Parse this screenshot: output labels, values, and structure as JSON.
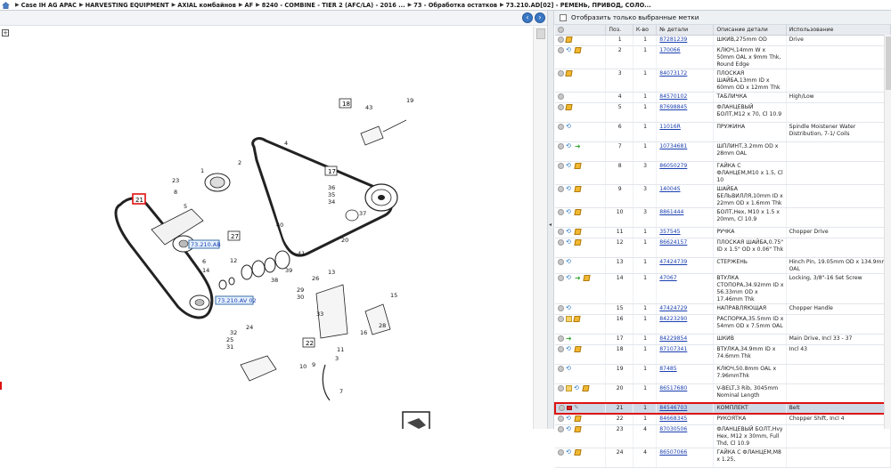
{
  "breadcrumb": {
    "items": [
      "Case IH AG APAC",
      "HARVESTING EQUIPMENT",
      "AXIAL комбайнов",
      "AF",
      "8240 - COMBINE - TIER 2 (AFC/LA) - 2016 ...",
      "73 - Обработка остатков",
      "73.210.AD[02] - РЕМЕНЬ, ПРИВОД, СОЛО..."
    ]
  },
  "filter": {
    "label": "Отобразить только выбранные метки"
  },
  "table": {
    "headers": [
      "",
      "Поз.",
      "К-во",
      "№ детали",
      "Описание детали",
      "Использование"
    ],
    "rows": [
      {
        "pos": "1",
        "qty": "1",
        "part": "87281239",
        "desc": "ШКИВ,275mm OD",
        "usage": "Drive",
        "icons": [
          "circ",
          "box"
        ]
      },
      {
        "pos": "2",
        "qty": "1",
        "part": "170066",
        "desc": "КЛЮЧ,14mm W x 50mm OAL x 9mm Thk, Round Edge",
        "usage": "",
        "icons": [
          "circ",
          "arr",
          "box"
        ]
      },
      {
        "pos": "3",
        "qty": "1",
        "part": "84073172",
        "desc": "ПЛОСКАЯ ШАЙБА,13mm ID x 60mm OD x 12mm Thk",
        "usage": "",
        "icons": [
          "circ",
          "box"
        ]
      },
      {
        "pos": "4",
        "qty": "1",
        "part": "84570102",
        "desc": "ТАБЛИЧКА",
        "usage": "High/Low",
        "icons": [
          "circ"
        ]
      },
      {
        "pos": "5",
        "qty": "1",
        "part": "87698845",
        "desc": "ФЛАНЦЕВЫЙ БОЛТ,M12 x 70, Cl 10.9",
        "usage": "",
        "icons": [
          "circ",
          "box"
        ]
      },
      {
        "pos": "6",
        "qty": "1",
        "part": "11016R",
        "desc": "ПРУЖИНА",
        "usage": "Spindle Moistener Water Distribution, 7-1/ Coils",
        "icons": [
          "circ",
          "arr"
        ]
      },
      {
        "pos": "7",
        "qty": "1",
        "part": "10734681",
        "desc": "ШПЛИНТ,3.2mm OD x 28mm OAL",
        "usage": "",
        "icons": [
          "circ",
          "arr",
          "green"
        ]
      },
      {
        "pos": "8",
        "qty": "3",
        "part": "86050279",
        "desc": "ГАЙКА С ФЛАНЦЕМ,M10 x 1.5, Cl 10",
        "usage": "",
        "icons": [
          "circ",
          "arr",
          "box"
        ]
      },
      {
        "pos": "9",
        "qty": "3",
        "part": "14004S",
        "desc": "ШАЙБА БЕЛЬВИЛЛЯ,10mm ID x 22mm OD x 1.6mm Thk",
        "usage": "",
        "icons": [
          "circ",
          "arr",
          "box"
        ]
      },
      {
        "pos": "10",
        "qty": "3",
        "part": "8861444",
        "desc": "БОЛТ,Hex, M10 x 1.5 x 20mm, Cl 10.9",
        "usage": "",
        "icons": [
          "circ",
          "arr",
          "box"
        ]
      },
      {
        "pos": "11",
        "qty": "1",
        "part": "357545",
        "desc": "РУЧКА",
        "usage": "Chopper Drive",
        "icons": [
          "circ",
          "arr",
          "box"
        ]
      },
      {
        "pos": "12",
        "qty": "1",
        "part": "86624157",
        "desc": "ПЛОСКАЯ ШАЙБА,0.75\" ID x 1.5\" OD x 0.06\" Thk",
        "usage": "",
        "icons": [
          "circ",
          "arr",
          "box"
        ]
      },
      {
        "pos": "13",
        "qty": "1",
        "part": "47424739",
        "desc": "СТЕРЖЕНЬ",
        "usage": "Hinch Pin, 19.05mm OD x 134.9mm OAL",
        "icons": [
          "circ",
          "arr"
        ]
      },
      {
        "pos": "14",
        "qty": "1",
        "part": "47067",
        "desc": "ВТУЛКА СТОПОРА,34.92mm ID x 56.33mm OD x 17.46mm Thk",
        "usage": "Locking, 3/8\"-16 Set Screw",
        "icons": [
          "circ",
          "arr",
          "green",
          "box"
        ]
      },
      {
        "pos": "15",
        "qty": "1",
        "part": "47424729",
        "desc": "НАПРАВЛЯЮЩАЯ",
        "usage": "Chopper Handle",
        "icons": [
          "circ",
          "arr"
        ]
      },
      {
        "pos": "16",
        "qty": "1",
        "part": "84223290",
        "desc": "РАСПОРКА,35.5mm ID x 54mm OD x 7.5mm OAL",
        "usage": "",
        "icons": [
          "circ",
          "note",
          "box"
        ]
      },
      {
        "pos": "17",
        "qty": "1",
        "part": "84229854",
        "desc": "ШКИВ",
        "usage": "Main Drive, Incl 33 - 37",
        "icons": [
          "circ",
          "green"
        ]
      },
      {
        "pos": "18",
        "qty": "1",
        "part": "87107341",
        "desc": "ВТУЛКА,34.9mm ID x 74.6mm Thk",
        "usage": "Incl 43",
        "icons": [
          "circ",
          "arr",
          "box"
        ]
      },
      {
        "pos": "19",
        "qty": "1",
        "part": "87485",
        "desc": "КЛЮЧ,50.8mm OAL x 7.96mmThk",
        "usage": "",
        "icons": [
          "circ",
          "arr"
        ]
      },
      {
        "pos": "20",
        "qty": "1",
        "part": "86517680",
        "desc": "V-BELT,3 Rib, 3045mm Nominal Length",
        "usage": "",
        "icons": [
          "circ",
          "note",
          "arr",
          "box"
        ]
      },
      {
        "pos": "21",
        "qty": "1",
        "part": "84546703",
        "desc": "КОМПЛЕКТ",
        "usage": "Belt",
        "icons": [
          "circ",
          "flag",
          "pen"
        ],
        "selected": true
      },
      {
        "pos": "22",
        "qty": "1",
        "part": "84668345",
        "desc": "РУКОЯТКА",
        "usage": "Chopper Shift, Incl 4",
        "icons": [
          "circ",
          "arr",
          "box"
        ]
      },
      {
        "pos": "23",
        "qty": "4",
        "part": "87030506",
        "desc": "ФЛАНЦЕВЫЙ БОЛТ,Hvy Hex, M12 x 30mm, Full Thd, Cl 10.9",
        "usage": "",
        "icons": [
          "circ",
          "arr",
          "box"
        ]
      },
      {
        "pos": "24",
        "qty": "4",
        "part": "86507066",
        "desc": "ГАЙКА С ФЛАНЦЕМ,M8 x 1.25,",
        "usage": "",
        "icons": [
          "circ",
          "arr",
          "box"
        ]
      }
    ]
  },
  "diagram": {
    "ref_boxes": [
      "18",
      "17",
      "21",
      "27",
      "22"
    ],
    "callouts": [
      "73.210.AB",
      "73.210.AV 02"
    ],
    "labels": [
      "19",
      "43",
      "2",
      "1",
      "4",
      "23",
      "8",
      "5",
      "36",
      "35",
      "34",
      "37",
      "17",
      "20",
      "40",
      "41",
      "39",
      "38",
      "6",
      "14",
      "12",
      "24",
      "32",
      "25",
      "31",
      "26",
      "13",
      "29",
      "30",
      "28",
      "33",
      "15",
      "16",
      "11",
      "10",
      "9",
      "3",
      "7"
    ]
  }
}
